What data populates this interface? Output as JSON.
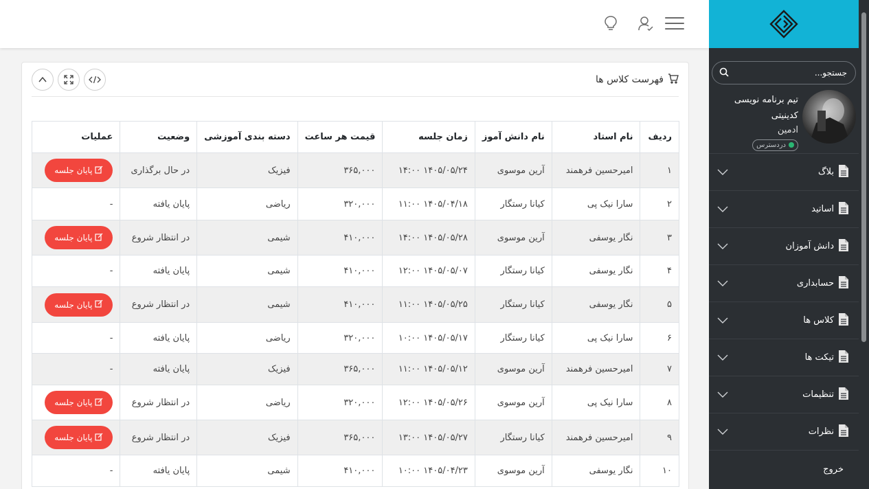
{
  "sidebar": {
    "search_placeholder": "جستجو...",
    "profile": {
      "name": "تیم برنامه نویسی کدینیتی",
      "role": "ادمین",
      "status": "دردسترس"
    },
    "menu": [
      {
        "label": "بلاگ"
      },
      {
        "label": "اساتید"
      },
      {
        "label": "دانش آموزان"
      },
      {
        "label": "حسابداری"
      },
      {
        "label": "کلاس ها"
      },
      {
        "label": "تیکت ها"
      },
      {
        "label": "تنظیمات"
      },
      {
        "label": "نظرات"
      }
    ],
    "logout_label": "خروج"
  },
  "card": {
    "title": "فهرست کلاس ها"
  },
  "table": {
    "headers": [
      "ردیف",
      "نام استاد",
      "نام دانش آموز",
      "زمان جلسه",
      "قیمت هر ساعت",
      "دسته بندی آموزشی",
      "وضعیت",
      "عملیات"
    ],
    "action_label": "پایان جلسه",
    "rows": [
      {
        "n": "۱",
        "teacher": "امیرحسین فرهمند",
        "student": "آرین موسوی",
        "time": "۱۴۰۵/۰۵/۲۴ ۱۴:۰۰",
        "price": "۳۶۵,۰۰۰",
        "category": "فیزیک",
        "status": "در حال برگذاری",
        "op": "پایان جلسه"
      },
      {
        "n": "۲",
        "teacher": "سارا نیک پی",
        "student": "کیانا رستگار",
        "time": "۱۴۰۵/۰۴/۱۸ ۱۱:۰۰",
        "price": "۳۲۰,۰۰۰",
        "category": "ریاضی",
        "status": "پایان یافته",
        "op": "-"
      },
      {
        "n": "۳",
        "teacher": "نگار یوسفی",
        "student": "آرین موسوی",
        "time": "۱۴۰۵/۰۵/۲۸ ۱۴:۰۰",
        "price": "۴۱۰,۰۰۰",
        "category": "شیمی",
        "status": "در انتظار شروع",
        "op": "پایان جلسه"
      },
      {
        "n": "۴",
        "teacher": "نگار یوسفی",
        "student": "کیانا رستگار",
        "time": "۱۴۰۵/۰۵/۰۷ ۱۲:۰۰",
        "price": "۴۱۰,۰۰۰",
        "category": "شیمی",
        "status": "پایان یافته",
        "op": "-"
      },
      {
        "n": "۵",
        "teacher": "نگار یوسفی",
        "student": "کیانا رستگار",
        "time": "۱۴۰۵/۰۵/۲۵ ۱۱:۰۰",
        "price": "۴۱۰,۰۰۰",
        "category": "شیمی",
        "status": "در انتظار شروع",
        "op": "پایان جلسه"
      },
      {
        "n": "۶",
        "teacher": "سارا نیک پی",
        "student": "کیانا رستگار",
        "time": "۱۴۰۵/۰۵/۱۷ ۱۰:۰۰",
        "price": "۳۲۰,۰۰۰",
        "category": "ریاضی",
        "status": "پایان یافته",
        "op": "-"
      },
      {
        "n": "۷",
        "teacher": "امیرحسین فرهمند",
        "student": "آرین موسوی",
        "time": "۱۴۰۵/۰۵/۱۲ ۱۱:۰۰",
        "price": "۳۶۵,۰۰۰",
        "category": "فیزیک",
        "status": "پایان یافته",
        "op": "-"
      },
      {
        "n": "۸",
        "teacher": "سارا نیک پی",
        "student": "آرین موسوی",
        "time": "۱۴۰۵/۰۵/۲۶ ۱۲:۰۰",
        "price": "۳۲۰,۰۰۰",
        "category": "ریاضی",
        "status": "در انتظار شروع",
        "op": "پایان جلسه"
      },
      {
        "n": "۹",
        "teacher": "امیرحسین فرهمند",
        "student": "کیانا رستگار",
        "time": "۱۴۰۵/۰۵/۲۷ ۱۳:۰۰",
        "price": "۳۶۵,۰۰۰",
        "category": "فیزیک",
        "status": "در انتظار شروع",
        "op": "پایان جلسه"
      },
      {
        "n": "۱۰",
        "teacher": "نگار یوسفی",
        "student": "آرین موسوی",
        "time": "۱۴۰۵/۰۴/۲۳ ۱۰:۰۰",
        "price": "۴۱۰,۰۰۰",
        "category": "شیمی",
        "status": "پایان یافته",
        "op": "-"
      }
    ]
  },
  "colors": {
    "accent": "#12b3d6",
    "sidebar_bg": "#2b2f33",
    "danger": "#f2463e",
    "online": "#2bb673"
  },
  "icons": {
    "topbar": [
      "menu-icon",
      "user-icon",
      "lightbulb-icon"
    ],
    "card_tools": [
      "chevron-up-icon",
      "expand-icon",
      "code-icon"
    ]
  }
}
